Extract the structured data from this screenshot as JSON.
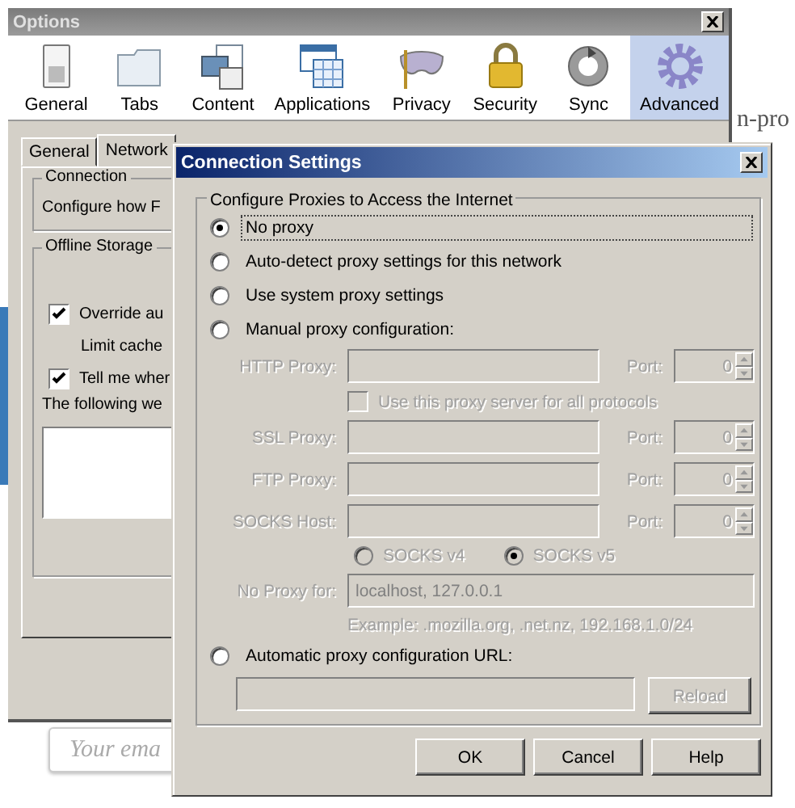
{
  "background_page": {
    "heading_fragment": "n-pro",
    "email_field": {
      "placeholder": "Your ema"
    }
  },
  "options_window": {
    "title": "Options",
    "panes": [
      {
        "label": "General",
        "selected": false
      },
      {
        "label": "Tabs",
        "selected": false
      },
      {
        "label": "Content",
        "selected": false
      },
      {
        "label": "Applications",
        "selected": false
      },
      {
        "label": "Privacy",
        "selected": false
      },
      {
        "label": "Security",
        "selected": false
      },
      {
        "label": "Sync",
        "selected": false
      },
      {
        "label": "Advanced",
        "selected": true
      }
    ],
    "tabs": [
      {
        "label": "General",
        "selected": false
      },
      {
        "label": "Network",
        "selected": true
      }
    ],
    "connection_group": {
      "title": "Connection",
      "description": "Configure how F"
    },
    "offline_storage": {
      "title": "Offline Storage",
      "override": {
        "label": "Override au",
        "checked": true
      },
      "limit_cache_label": "Limit cache",
      "notify": {
        "label": "Tell me wher",
        "checked": true
      },
      "websites_label": "The following we"
    }
  },
  "connection_dialog": {
    "title": "Connection Settings",
    "group_title": "Configure Proxies to Access the Internet",
    "proxy_modes": [
      {
        "label": "No proxy",
        "selected": true,
        "focused": true
      },
      {
        "label": "Auto-detect proxy settings for this network",
        "selected": false,
        "focused": false
      },
      {
        "label": "Use system proxy settings",
        "selected": false,
        "focused": false
      },
      {
        "label": "Manual proxy configuration:",
        "selected": false,
        "focused": false
      }
    ],
    "disabled": true,
    "http": {
      "label": "HTTP Proxy:",
      "port_label": "Port:",
      "port": "0"
    },
    "share_all": {
      "label": "Use this proxy server for all protocols",
      "checked": false
    },
    "proxies": [
      {
        "label": "SSL Proxy:",
        "port_label": "Port:",
        "port": "0"
      },
      {
        "label": "FTP Proxy:",
        "port_label": "Port:",
        "port": "0"
      },
      {
        "label": "SOCKS Host:",
        "port_label": "Port:",
        "port": "0"
      }
    ],
    "socks_versions": [
      {
        "label": "SOCKS v4",
        "selected": false
      },
      {
        "label": "SOCKS v5",
        "selected": true
      }
    ],
    "no_proxy": {
      "label": "No Proxy for:",
      "value": "localhost, 127.0.0.1",
      "example": "Example: .mozilla.org, .net.nz, 192.168.1.0/24"
    },
    "auto_config": {
      "label": "Automatic proxy configuration URL:",
      "selected": false,
      "reload": "Reload"
    },
    "buttons": [
      "OK",
      "Cancel",
      "Help"
    ]
  }
}
